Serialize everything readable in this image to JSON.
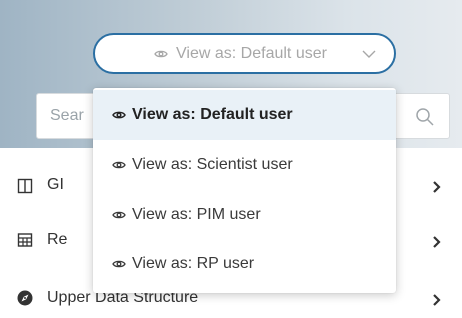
{
  "view_as": {
    "button_label": "View as: Default user",
    "chevron_icon": "chevron-down-icon",
    "eye_icon": "eye-icon"
  },
  "search": {
    "visible_placeholder": "Sear",
    "icon": "search-icon"
  },
  "nav": {
    "items": [
      {
        "label": "GI",
        "icon": "columns-icon"
      },
      {
        "label": "Re",
        "icon": "table-icon"
      },
      {
        "label": "Upper Data Structure",
        "icon": "compass-icon"
      }
    ],
    "chevron_icon": "chevron-right-icon"
  },
  "dropdown": {
    "options": [
      {
        "label": "View as: Default user",
        "selected": true
      },
      {
        "label": "View as: Scientist user",
        "selected": false
      },
      {
        "label": "View as: PIM user",
        "selected": false
      },
      {
        "label": "View as: RP user",
        "selected": false
      }
    ]
  },
  "colors": {
    "accent_border": "#2b6fa3",
    "selected_bg": "#e9f1f7",
    "header_gradient_start": "#9fb4c4",
    "header_gradient_end": "#e6ebef"
  }
}
